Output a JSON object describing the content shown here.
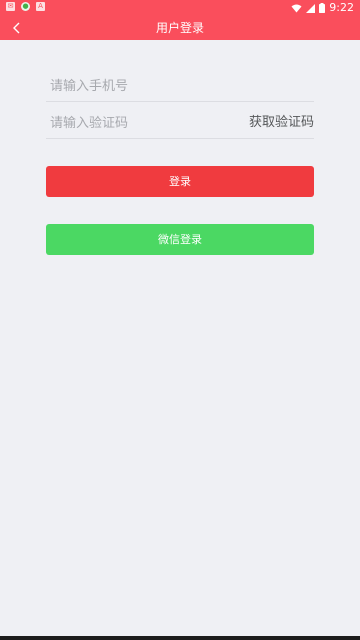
{
  "status_bar": {
    "time": "9:22",
    "left_icons": [
      "message-icon",
      "app-icon",
      "download-icon"
    ],
    "right_icons": [
      "wifi-icon",
      "signal-icon",
      "battery-icon"
    ]
  },
  "header": {
    "title": "用户登录",
    "background": "#fa4e5c"
  },
  "form": {
    "phone_placeholder": "请输入手机号",
    "code_placeholder": "请输入验证码",
    "get_code_label": "获取验证码"
  },
  "buttons": {
    "login_label": "登录",
    "login_color": "#f03b3f",
    "wechat_label": "微信登录",
    "wechat_color": "#4bd863"
  }
}
